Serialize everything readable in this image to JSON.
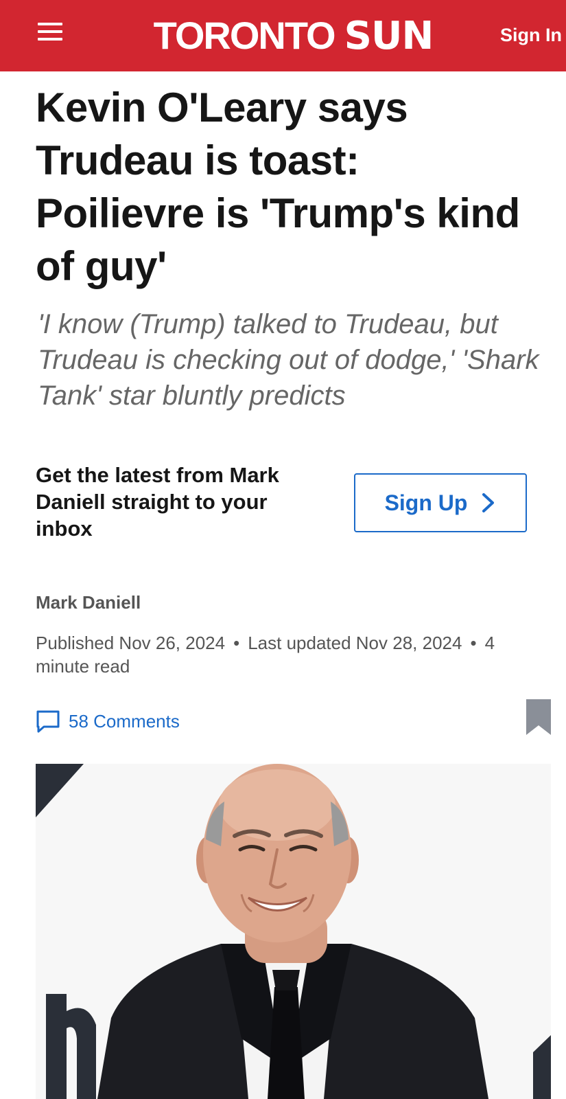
{
  "header": {
    "logo_part1": "TORONTO",
    "logo_part2": "SUN",
    "signin_label": "Sign In",
    "bg_color": "#d22630"
  },
  "article": {
    "headline": "Kevin O'Leary says Trudeau is toast: Poilievre is 'Trump's kind of guy'",
    "subheadline": "'I know (Trump) talked to Trudeau, but Trudeau is checking out of dodge,' 'Shark Tank' star bluntly predicts",
    "author": "Mark Daniell",
    "published": "Published Nov 26, 2024",
    "updated": "Last updated Nov 28, 2024",
    "read_time": "4 minute read",
    "separator": "•"
  },
  "newsletter": {
    "text": "Get the latest from Mark Daniell straight to your inbox",
    "button_label": "Sign Up",
    "accent_color": "#1b6ac9"
  },
  "engagement": {
    "comments_label": "58 Comments",
    "comment_icon": "comment-icon",
    "bookmark_icon": "bookmark-icon"
  },
  "photo": {
    "subject_icon": "photo-image"
  }
}
